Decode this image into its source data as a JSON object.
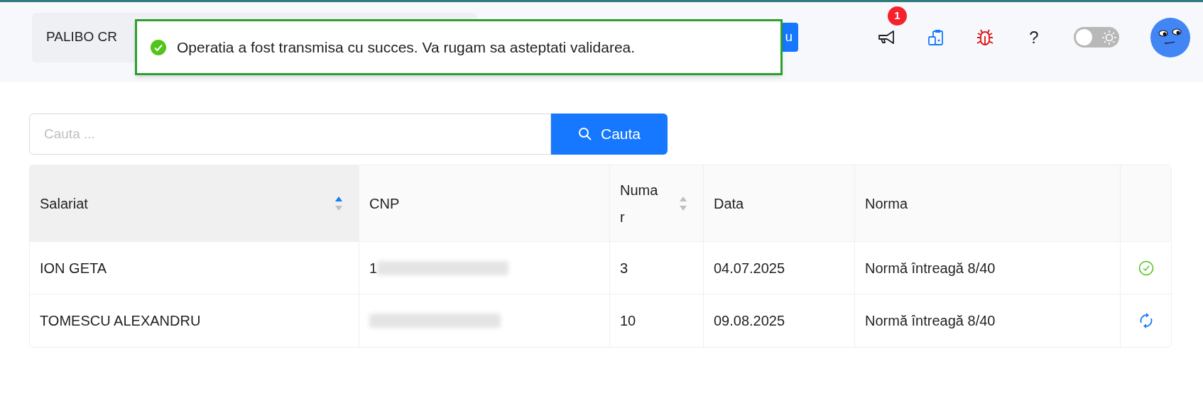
{
  "header": {
    "company": "PALIBO CR",
    "button": "u",
    "notifications": {
      "count": "1"
    },
    "help": "?",
    "theme_toggle": {
      "on": false
    }
  },
  "toast": {
    "message": "Operatia a fost transmisa cu succes. Va rugam sa asteptati validarea."
  },
  "search": {
    "placeholder": "Cauta ...",
    "button": "Cauta"
  },
  "table": {
    "columns": [
      {
        "label": "Salariat",
        "sortable": true,
        "sorted": true
      },
      {
        "label": "CNP"
      },
      {
        "label": "Numar",
        "sortable": true,
        "sorted": false
      },
      {
        "label": "Data"
      },
      {
        "label": "Norma"
      }
    ],
    "rows": [
      {
        "salariat": "ION GETA",
        "cnp": {
          "text": "1",
          "redacted": true
        },
        "numar": "3",
        "data": "04.07.2025",
        "norma": "Normă întreagă 8/40",
        "kind": "validated"
      },
      {
        "salariat": "TOMESCU ALEXANDRU",
        "cnp": {
          "redacted": true
        },
        "numar": "10",
        "data": "09.08.2025",
        "norma": "Normă întreagă 8/40",
        "kind": "pending"
      }
    ]
  }
}
